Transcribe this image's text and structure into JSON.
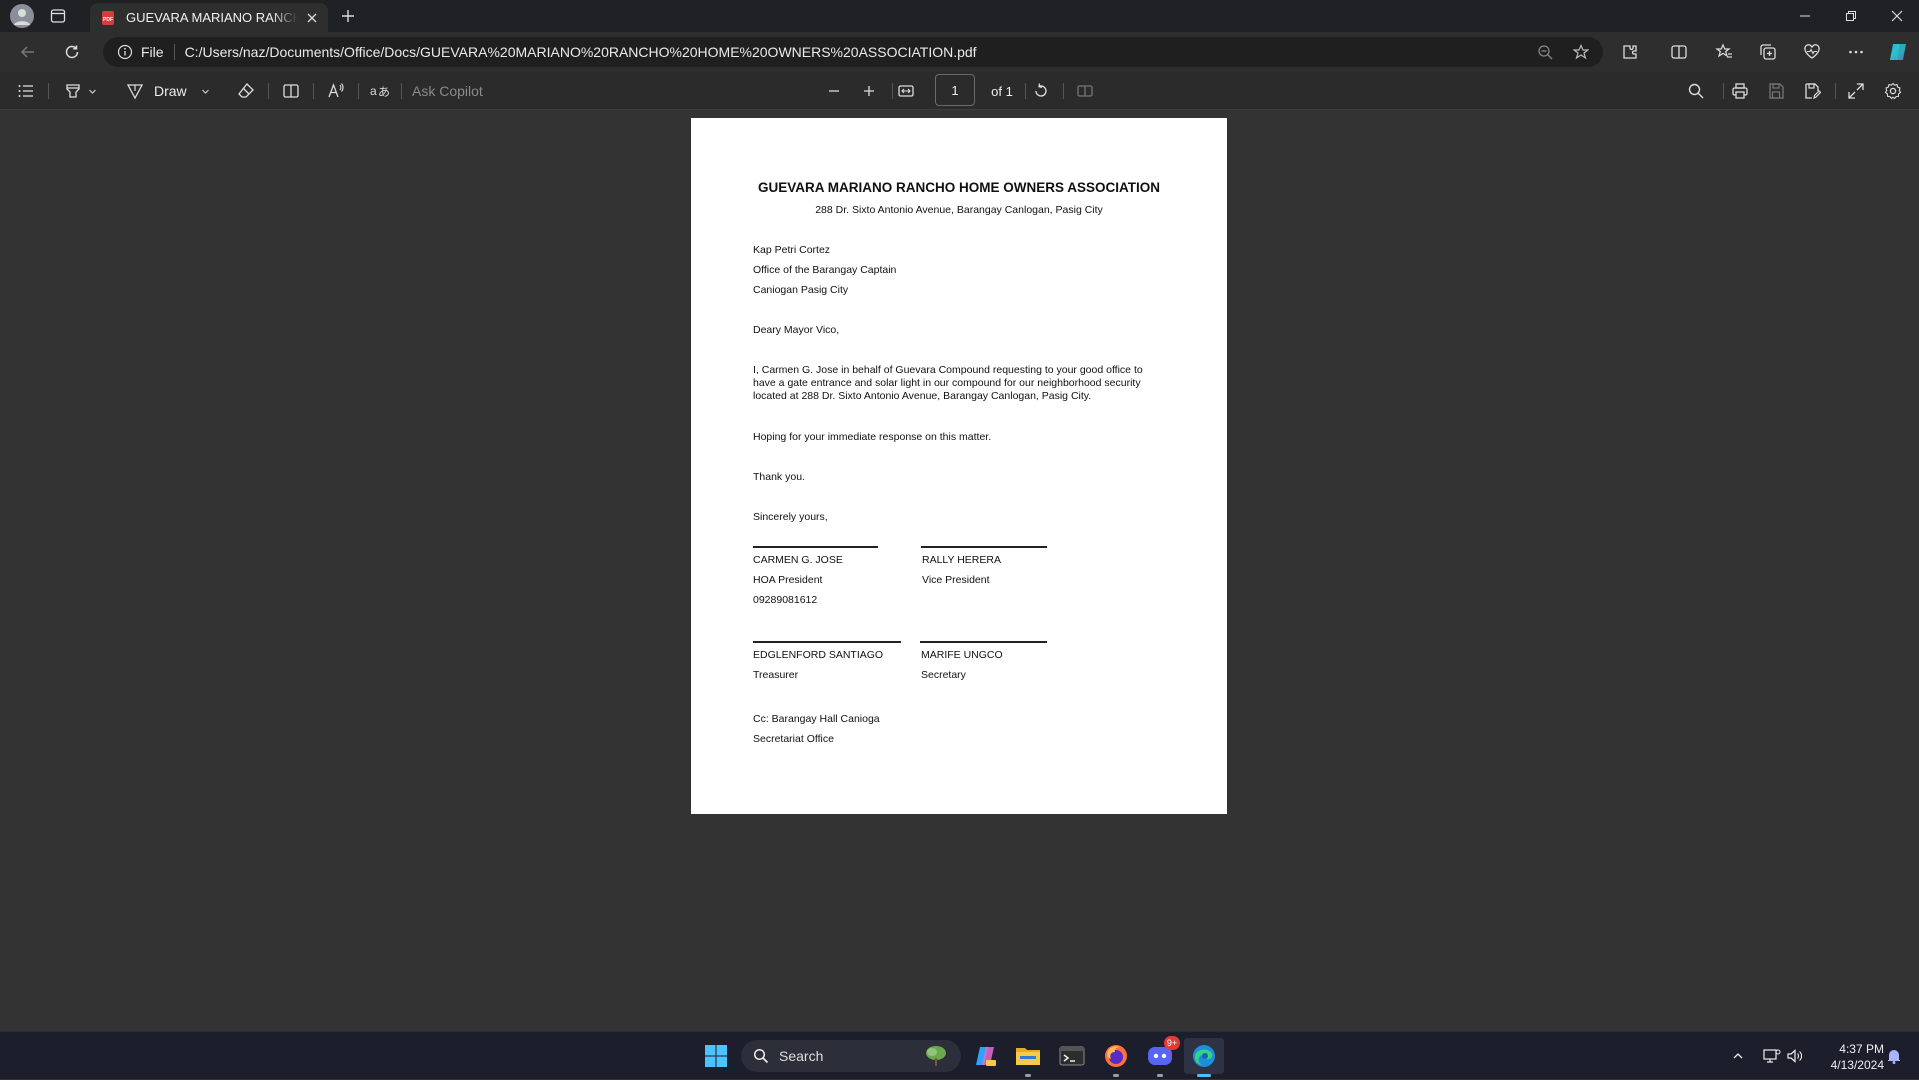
{
  "browser": {
    "tab_title": "GUEVARA MARIANO RANCHO HOME OWNERS ASSOCIATION.pdf",
    "address_scheme_label": "File",
    "url": "C:/Users/naz/Documents/Office/Docs/GUEVARA%20MARIANO%20RANCHO%20HOME%20OWNERS%20ASSOCIATION.pdf"
  },
  "pdf_toolbar": {
    "draw_label": "Draw",
    "ask_copilot": "Ask Copilot",
    "page_number": "1",
    "page_total": "of 1"
  },
  "document": {
    "title": "GUEVARA MARIANO RANCHO HOME OWNERS ASSOCIATION",
    "address": "288 Dr. Sixto Antonio Avenue, Barangay Canlogan, Pasig City",
    "recipient": [
      "Kap Petri Cortez",
      "Office of the Barangay Captain",
      "Caniogan Pasig City"
    ],
    "salutation": "Deary Mayor Vico,",
    "body": "I, Carmen G. Jose in behalf of Guevara Compound requesting to your good office to have a gate entrance and solar light in our compound for our neighborhood security located at 288 Dr. Sixto Antonio Avenue, Barangay Canlogan, Pasig City.",
    "closing_request": "Hoping for your immediate response on this matter.",
    "thanks": "Thank you.",
    "signoff": "Sincerely yours,",
    "signatories": [
      {
        "name": "CARMEN G. JOSE",
        "role": "HOA President",
        "phone": "09289081612"
      },
      {
        "name": "RALLY HERERA",
        "role": "Vice President"
      },
      {
        "name": "EDGLENFORD SANTIAGO",
        "role": "Treasurer"
      },
      {
        "name": "MARIFE UNGCO",
        "role": "Secretary"
      }
    ],
    "cc": [
      "Cc: Barangay Hall Canioga",
      "Secretariat Office"
    ]
  },
  "taskbar": {
    "search_placeholder": "Search",
    "discord_badge": "9+",
    "time": "4:37 PM",
    "date": "4/13/2024"
  },
  "colors": {
    "accent": "#0078d4",
    "page": "#ffffff",
    "viewer_bg": "#333333"
  }
}
